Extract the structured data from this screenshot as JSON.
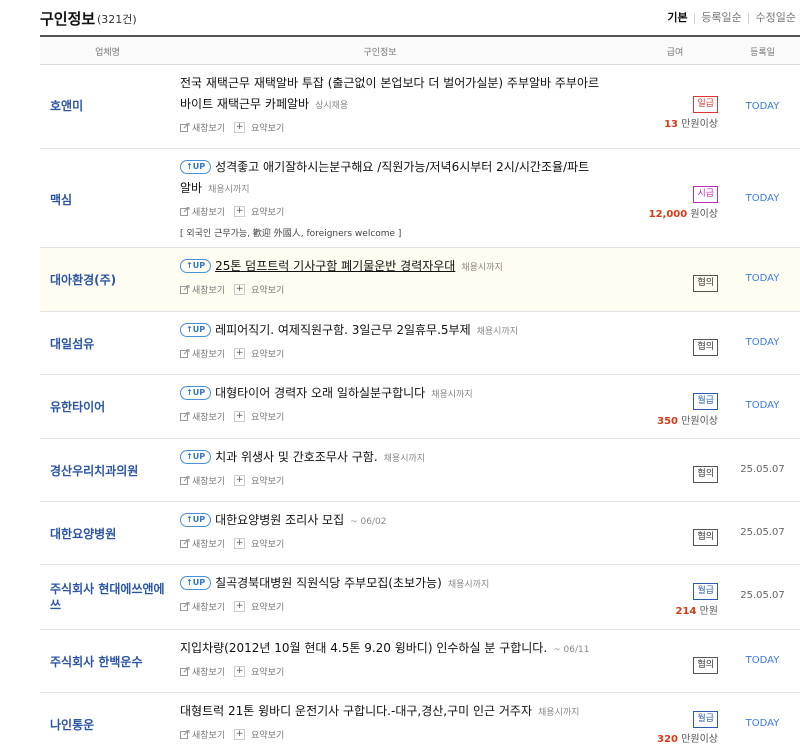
{
  "header": {
    "title": "구인정보",
    "count": "(321건)",
    "sort_options": [
      "기본",
      "등록일순",
      "수정일순"
    ]
  },
  "table": {
    "columns": [
      "업체명",
      "구인정보",
      "급여",
      "등록일"
    ]
  },
  "common": {
    "newwin_label": "새창보기",
    "summary_label": "요약보기",
    "up_label": "UP"
  },
  "rows": [
    {
      "company": "호앤미",
      "up": false,
      "title": "전국 재택근무 재택알바 투잡 (출근없이 본업보다 더 벌어가실분) 주부알바 주부아르바이트 재택근무 카페알바",
      "period": "상시채용",
      "pay_type": "일급",
      "pay_amount": "13",
      "pay_unit": "만원이상",
      "date": "TODAY"
    },
    {
      "company": "맥심",
      "up": true,
      "title": "성격좋고 애기잘하시는분구해요 /직원가능/저녁6시부터 2시/시간조율/파트알바",
      "period": "채용시까지",
      "pay_type": "시급",
      "pay_amount": "12,000",
      "pay_unit": "원이상",
      "date": "TODAY",
      "extra": "[ 외국인 근무가능, 歡迎 外國人, foreigners welcome ]"
    },
    {
      "company": "대아환경(주)",
      "up": true,
      "title": "25톤 덤프트럭 기사구함 폐기물운반 경력자우대",
      "period": "채용시까지",
      "pay_type": "협의",
      "pay_amount": "",
      "pay_unit": "",
      "date": "TODAY"
    },
    {
      "company": "대일섬유",
      "up": true,
      "title": "레피어직기. 여제직원구함. 3일근무 2일휴무.5부제",
      "period": "채용시까지",
      "pay_type": "협의",
      "pay_amount": "",
      "pay_unit": "",
      "date": "TODAY"
    },
    {
      "company": "유한타이어",
      "up": true,
      "title": "대형타이어 경력자 오래 일하실분구합니다",
      "period": "채용시까지",
      "pay_type": "월급",
      "pay_amount": "350",
      "pay_unit": "만원이상",
      "date": "TODAY"
    },
    {
      "company": "경산우리치과의원",
      "up": true,
      "title": "치과 위생사 및 간호조무사 구함.",
      "period": "채용시까지",
      "pay_type": "협의",
      "pay_amount": "",
      "pay_unit": "",
      "date": "25.05.07"
    },
    {
      "company": "대한요양병원",
      "up": true,
      "title": "대한요양병원 조리사 모집",
      "period": "~ 06/02",
      "pay_type": "협의",
      "pay_amount": "",
      "pay_unit": "",
      "date": "25.05.07"
    },
    {
      "company": "주식회사 현대에쓰앤에쓰",
      "up": true,
      "title": "칠곡경북대병원 직원식당 주부모집(초보가능)",
      "period": "채용시까지",
      "pay_type": "월급",
      "pay_amount": "214",
      "pay_unit": "만원",
      "date": "25.05.07"
    },
    {
      "company": "주식회사 한백운수",
      "up": false,
      "title": "지입차량(2012년 10월 현대 4.5톤 9.20 윙바디) 인수하실 분 구합니다.",
      "period": "~ 06/11",
      "pay_type": "협의",
      "pay_amount": "",
      "pay_unit": "",
      "date": "TODAY"
    },
    {
      "company": "나인통운",
      "up": false,
      "title": "대형트럭 21톤 윙바디 운전기사 구합니다.-대구,경산,구미 인근 거주자",
      "period": "채용시까지",
      "pay_type": "월급",
      "pay_amount": "320",
      "pay_unit": "만원이상",
      "date": "TODAY"
    }
  ]
}
